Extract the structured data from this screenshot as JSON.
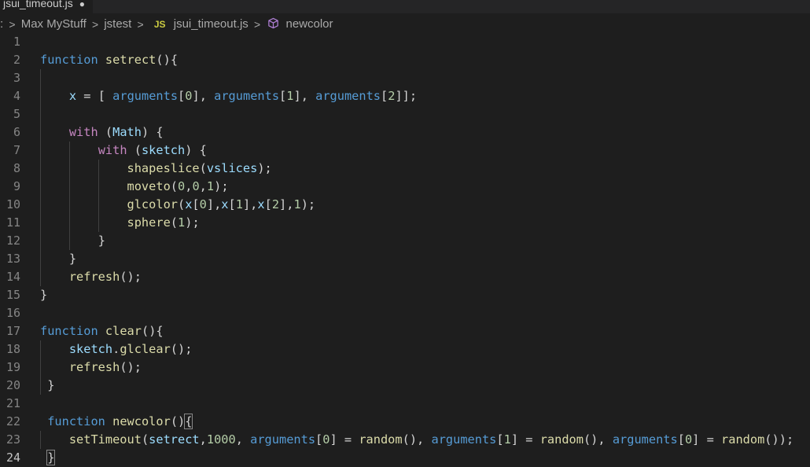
{
  "tab": {
    "label": "jsui_timeout.js",
    "dirty_marker": "●"
  },
  "breadcrumb": {
    "ellipsis": ":",
    "items": [
      "Max MyStuff",
      "jstest",
      "jsui_timeout.js",
      "newcolor"
    ],
    "js_badge": "JS",
    "separator": ">",
    "file_icon": "javascript-file-icon",
    "symbol_icon": "cube-icon"
  },
  "editor": {
    "active_line": 24,
    "lines": [
      {
        "n": "1",
        "t": ""
      },
      {
        "n": "2",
        "t": "function setrect(){"
      },
      {
        "n": "3",
        "t": ""
      },
      {
        "n": "4",
        "t": "    x = [ arguments[0], arguments[1], arguments[2]];"
      },
      {
        "n": "5",
        "t": ""
      },
      {
        "n": "6",
        "t": "    with (Math) {"
      },
      {
        "n": "7",
        "t": "        with (sketch) {"
      },
      {
        "n": "8",
        "t": "            shapeslice(vslices);"
      },
      {
        "n": "9",
        "t": "            moveto(0,0,1);"
      },
      {
        "n": "10",
        "t": "            glcolor(x[0],x[1],x[2],1);"
      },
      {
        "n": "11",
        "t": "            sphere(1);"
      },
      {
        "n": "12",
        "t": "        }"
      },
      {
        "n": "13",
        "t": "    }"
      },
      {
        "n": "14",
        "t": "    refresh();"
      },
      {
        "n": "15",
        "t": "}"
      },
      {
        "n": "16",
        "t": ""
      },
      {
        "n": "17",
        "t": "function clear(){"
      },
      {
        "n": "18",
        "t": "    sketch.glclear();"
      },
      {
        "n": "19",
        "t": "    refresh();"
      },
      {
        "n": "20",
        "t": " }"
      },
      {
        "n": "21",
        "t": ""
      },
      {
        "n": "22",
        "t": " function newcolor(){"
      },
      {
        "n": "23",
        "t": "    setTimeout(setrect,1000, arguments[0] = random(), arguments[1] = random(), arguments[0] = random());"
      },
      {
        "n": "24",
        "t": " }"
      }
    ]
  },
  "colors": {
    "background": "#1e1e1e",
    "keyword": "#569cd6",
    "function": "#dcdcaa",
    "control": "#c586c0",
    "variable": "#9cdcfe",
    "number": "#b5cea8",
    "line_number": "#858585"
  }
}
